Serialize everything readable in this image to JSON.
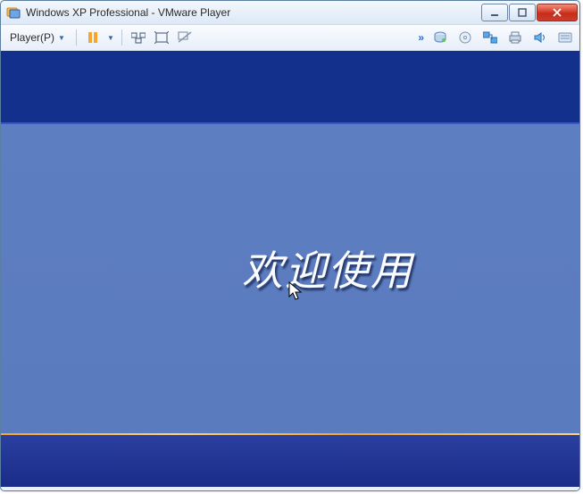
{
  "window": {
    "title": "Windows XP Professional - VMware Player"
  },
  "toolbar": {
    "player_label": "Player(P)"
  },
  "guest": {
    "welcome_text": "欢迎使用"
  }
}
